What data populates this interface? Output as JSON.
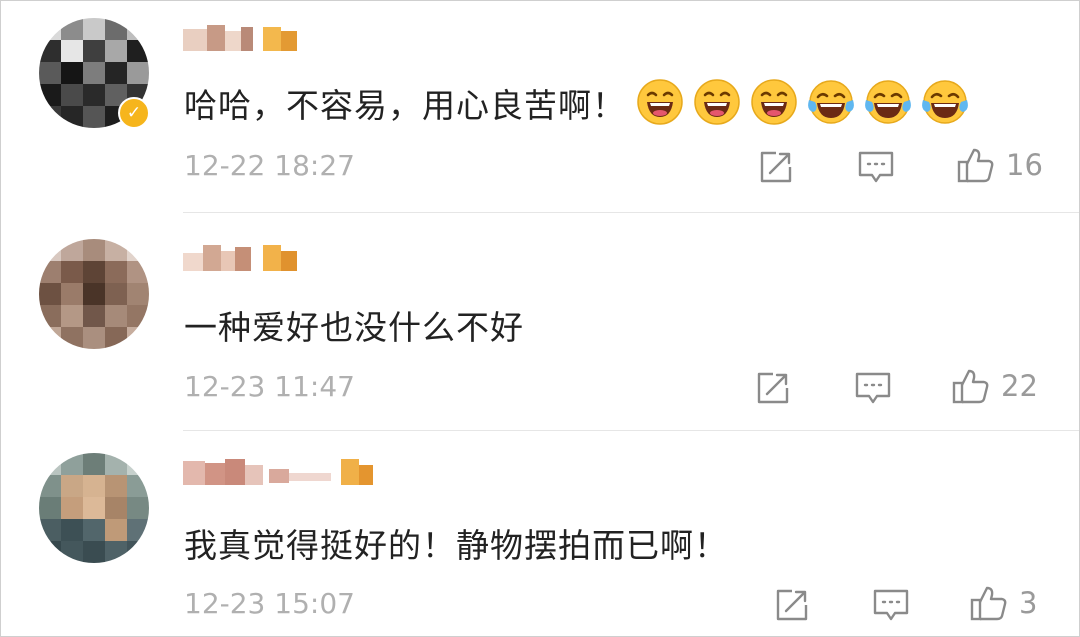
{
  "comments": [
    {
      "text": "哈哈，不容易，用心良苦啊！",
      "emojis": [
        "laughing-emoji",
        "laughing-emoji",
        "laughing-emoji",
        "tears-of-joy-emoji",
        "tears-of-joy-emoji",
        "tears-of-joy-emoji"
      ],
      "verified_badge": "✓",
      "time": "12-22 18:27",
      "likes": "16"
    },
    {
      "text": "一种爱好也没什么不好",
      "time": "12-23 11:47",
      "likes": "22"
    },
    {
      "text": "我真觉得挺好的！静物摆拍而已啊！",
      "time": "12-23 15:07",
      "likes": "3"
    }
  ],
  "icons": {
    "share": "share-icon",
    "reply": "reply-icon",
    "like": "thumbs-up-icon"
  },
  "colors": {
    "text": "#222222",
    "timestamp": "#b0b0b0",
    "icon": "#8a8a8a",
    "verified_badge": "#f6b51c",
    "emoji_face": "#ffc83d"
  }
}
